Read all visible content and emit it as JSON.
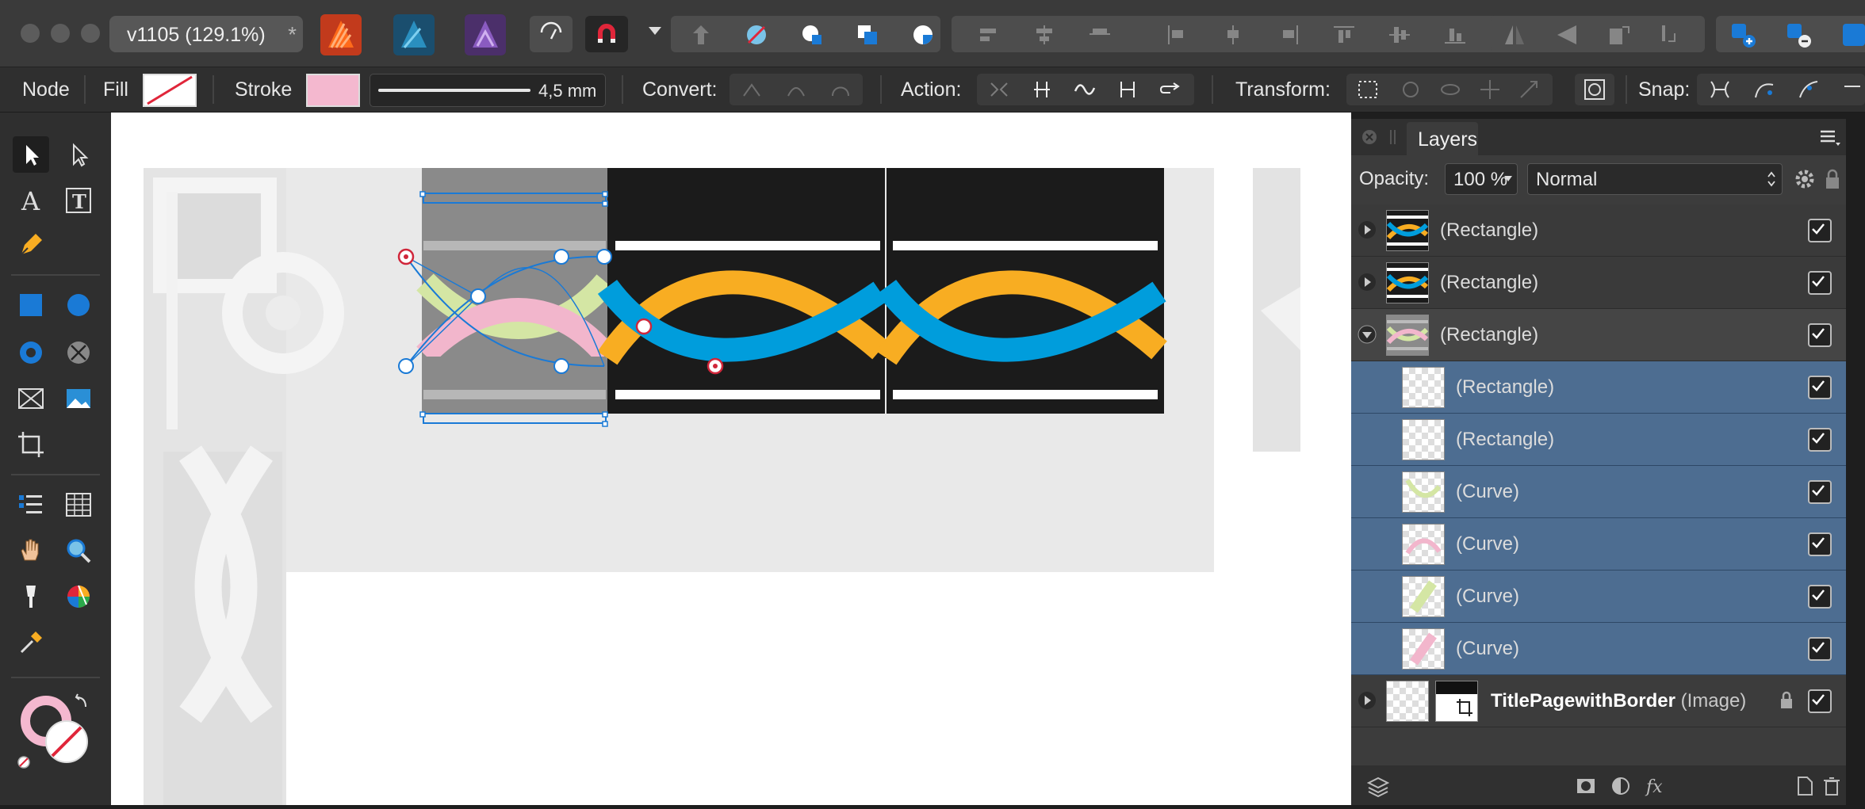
{
  "window": {
    "doc_title": "v1105  (129.1%)",
    "doc_modified": "*"
  },
  "context_bar": {
    "mode": "Node",
    "fill_label": "Fill",
    "stroke_label": "Stroke",
    "stroke_width": "4,5 mm",
    "convert_label": "Convert:",
    "action_label": "Action:",
    "transform_label": "Transform:",
    "snap_label": "Snap:"
  },
  "layers_panel": {
    "title": "Layers",
    "opacity_label": "Opacity:",
    "opacity_value": "100 %",
    "blend_mode": "Normal",
    "layers": [
      {
        "name": "(Rectangle)",
        "type": "",
        "state": "collapsed",
        "visible": true
      },
      {
        "name": "(Rectangle)",
        "type": "",
        "state": "collapsed",
        "visible": true
      },
      {
        "name": "(Rectangle)",
        "type": "",
        "state": "expanded",
        "visible": true
      },
      {
        "name": "(Rectangle)",
        "type": "",
        "state": "child-selected",
        "visible": true
      },
      {
        "name": "(Rectangle)",
        "type": "",
        "state": "child-selected",
        "visible": true
      },
      {
        "name": "(Curve)",
        "type": "",
        "state": "child-selected",
        "visible": true
      },
      {
        "name": "(Curve)",
        "type": "",
        "state": "child-selected",
        "visible": true
      },
      {
        "name": "(Curve)",
        "type": "",
        "state": "child-selected",
        "visible": true
      },
      {
        "name": "(Curve)",
        "type": "",
        "state": "child-selected",
        "visible": true
      },
      {
        "name": "TitlePagewithBorder",
        "type": "(Image)",
        "state": "collapsed-locked",
        "visible": true
      }
    ]
  },
  "colors": {
    "stroke": "#f4b8cf",
    "yellow_band": "#f8ad22",
    "blue_band": "#009ddc",
    "pink_band": "#f2b6cc",
    "green_band": "#d4e6a4",
    "selection_blue": "#1a7ad6",
    "layer_selected": "#4d6d91"
  }
}
